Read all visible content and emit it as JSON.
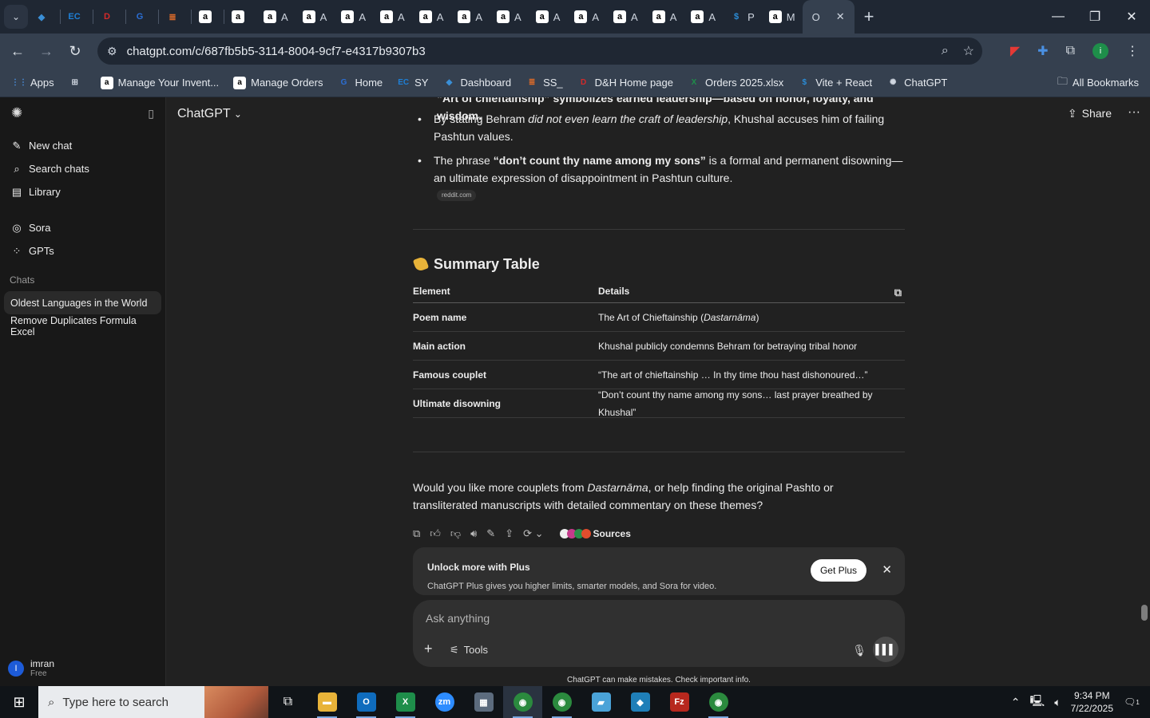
{
  "browser": {
    "tabs": [
      {
        "label": "",
        "icon": "diamond",
        "color": "#3a8fd6"
      },
      {
        "label": "",
        "icon": "EC",
        "color": "#1e7fd6"
      },
      {
        "label": "",
        "icon": "DH",
        "color": "#d42a2a"
      },
      {
        "label": "",
        "icon": "G",
        "color": "#2b6fd6"
      },
      {
        "label": "",
        "icon": "stack",
        "color": "#d96a2a"
      },
      {
        "label": "",
        "icon": "a",
        "color": "#ffffff"
      },
      {
        "label": "",
        "icon": "a",
        "color": "#ffffff"
      },
      {
        "label": "A",
        "icon": "a",
        "color": "#ffffff"
      },
      {
        "label": "A",
        "icon": "a",
        "color": "#ffffff"
      },
      {
        "label": "A",
        "icon": "a",
        "color": "#ffffff"
      },
      {
        "label": "A",
        "icon": "a",
        "color": "#ffffff"
      },
      {
        "label": "A",
        "icon": "a",
        "color": "#ffffff"
      },
      {
        "label": "A",
        "icon": "a",
        "color": "#ffffff"
      },
      {
        "label": "A",
        "icon": "a",
        "color": "#ffffff"
      },
      {
        "label": "A",
        "icon": "a",
        "color": "#ffffff"
      },
      {
        "label": "A",
        "icon": "a",
        "color": "#ffffff"
      },
      {
        "label": "A",
        "icon": "a",
        "color": "#ffffff"
      },
      {
        "label": "A",
        "icon": "a",
        "color": "#ffffff"
      },
      {
        "label": "A",
        "icon": "a",
        "color": "#ffffff"
      },
      {
        "label": "P",
        "icon": "S",
        "color": "#2b8cd6"
      },
      {
        "label": "M",
        "icon": "a",
        "color": "#ffffff"
      }
    ],
    "active_tab_label": "O",
    "url": "chatgpt.com/c/687fb5b5-3114-8004-9cf7-e4317b9307b3",
    "bookmarks": [
      {
        "label": "Apps",
        "icon": "grid",
        "color": "#4a90e2"
      },
      {
        "label": "",
        "icon": "grid2",
        "color": "#cfd6e0"
      },
      {
        "label": "Manage Your Invent...",
        "icon": "a",
        "color": "#ffffff"
      },
      {
        "label": "Manage Orders",
        "icon": "a",
        "color": "#ffffff"
      },
      {
        "label": "Home",
        "icon": "G",
        "color": "#2b6fd6"
      },
      {
        "label": "SY",
        "icon": "EC",
        "color": "#1e7fd6"
      },
      {
        "label": "Dashboard",
        "icon": "diamond",
        "color": "#3a8fd6"
      },
      {
        "label": "SS_",
        "icon": "stack",
        "color": "#d96a2a"
      },
      {
        "label": "D&H Home page",
        "icon": "DH",
        "color": "#d42a2a"
      },
      {
        "label": "Orders 2025.xlsx",
        "icon": "X",
        "color": "#1e8e4a"
      },
      {
        "label": "Vite + React",
        "icon": "S",
        "color": "#2b8cd6"
      },
      {
        "label": "ChatGPT",
        "icon": "gpt",
        "color": "#cfd6e0"
      }
    ],
    "all_bookmarks": "All Bookmarks"
  },
  "sidebar": {
    "items": [
      {
        "label": "New chat",
        "icon": "edit-icon"
      },
      {
        "label": "Search chats",
        "icon": "search-icon"
      },
      {
        "label": "Library",
        "icon": "library-icon"
      }
    ],
    "items2": [
      {
        "label": "Sora",
        "icon": "play-icon"
      },
      {
        "label": "GPTs",
        "icon": "gpts-icon"
      }
    ],
    "chats_label": "Chats",
    "chats": [
      {
        "label": "Oldest Languages in the World",
        "active": true
      },
      {
        "label": "Remove Duplicates Formula Excel",
        "active": false
      }
    ],
    "user": {
      "initial": "I",
      "name": "imran",
      "plan": "Free"
    }
  },
  "main": {
    "title": "ChatGPT",
    "share_label": "Share",
    "cut_line": "“Art of chieftainship” symbolizes earned leadership—based on honor, loyalty, and wisdom.",
    "bullet1_pre": "By stating Behram ",
    "bullet1_em": "did not even learn the craft of leadership",
    "bullet1_post": ", Khushal accuses him of failing Pashtun values.",
    "bullet2_pre": "The phrase ",
    "bullet2_strong": "“don’t count thy name among my sons”",
    "bullet2_post": " is a formal and permanent disowning—an ultimate expression of disappointment in Pashtun culture.",
    "source_chip": "reddit.com",
    "summary_heading": "Summary Table",
    "table": {
      "headers": [
        "Element",
        "Details"
      ],
      "rows": [
        [
          "Poem name",
          "The Art of Chieftainship (",
          "Dastarnāma",
          ")"
        ],
        [
          "Main action",
          "Khushal publicly condemns Behram for betraying tribal honor",
          "",
          ""
        ],
        [
          "Famous couplet",
          "“The art of chieftainship … In thy time thou hast dishonoured…”",
          "",
          ""
        ],
        [
          "Ultimate disowning",
          "“Don’t count thy name among my sons… last prayer breathed by Khushal”",
          "",
          ""
        ]
      ]
    },
    "followup_pre": "Would you like more couplets from ",
    "followup_em": "Dastarnāma",
    "followup_post": ", or help finding the original Pashto or transliterated manuscripts with detailed commentary on these themes?",
    "sources_label": "Sources",
    "banner": {
      "title": "Unlock more with Plus",
      "subtitle": "ChatGPT Plus gives you higher limits, smarter models, and Sora for video.",
      "button": "Get Plus"
    },
    "composer": {
      "placeholder": "Ask anything",
      "tools_label": "Tools"
    },
    "disclaimer": "ChatGPT can make mistakes. Check important info."
  },
  "taskbar": {
    "search_placeholder": "Type here to search",
    "time": "9:34 PM",
    "date": "7/22/2025",
    "notif_count": "1"
  }
}
